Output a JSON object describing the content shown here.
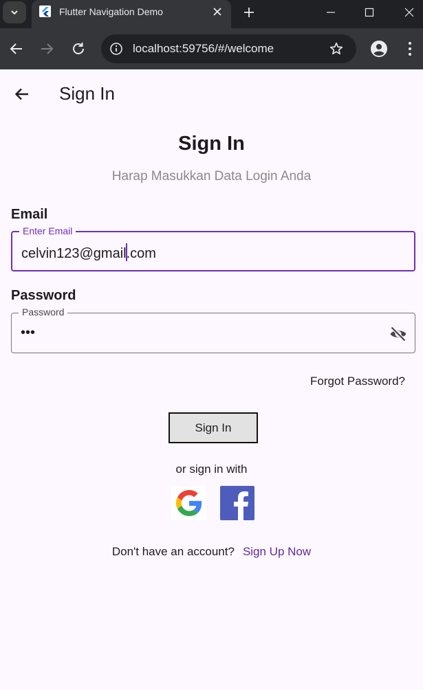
{
  "browser": {
    "tab_title": "Flutter Navigation Demo",
    "url": "localhost:59756/#/welcome"
  },
  "appbar": {
    "title": "Sign In"
  },
  "form": {
    "heading": "Sign In",
    "subheading": "Harap Masukkan Data Login Anda",
    "email": {
      "label": "Email",
      "floating_label": "Enter Email",
      "value_before_caret": "celvin123@gmail",
      "value_after_caret": ".com"
    },
    "password": {
      "label": "Password",
      "floating_label": "Password",
      "value": "•••"
    },
    "forgot_password": "Forgot Password?",
    "submit_label": "Sign In",
    "social_prompt": "or sign in with",
    "signup_prompt": "Don't have an account?",
    "signup_link": "Sign Up Now"
  },
  "colors": {
    "background": "#fdf7ff",
    "accent": "#6d31b5",
    "link": "#5e2aa0",
    "facebook": "#4e5dbc"
  },
  "icons": {
    "back": "arrow-left-icon",
    "visibility": "eye-off-icon",
    "google": "google-logo",
    "facebook": "facebook-logo"
  }
}
